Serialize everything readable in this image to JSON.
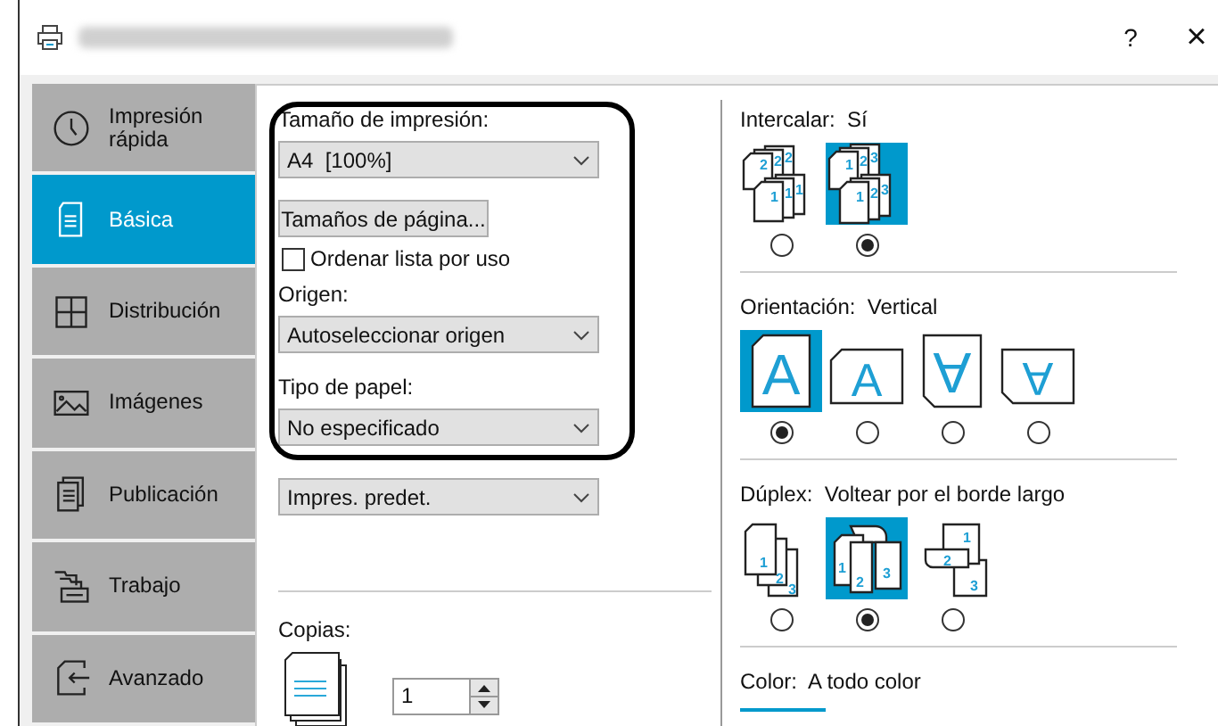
{
  "window": {
    "help": "?",
    "close": "×"
  },
  "sidebar": {
    "items": [
      {
        "label": "Impresión rápida",
        "selected": false
      },
      {
        "label": "Básica",
        "selected": true
      },
      {
        "label": "Distribución",
        "selected": false
      },
      {
        "label": "Imágenes",
        "selected": false
      },
      {
        "label": "Publicación",
        "selected": false
      },
      {
        "label": "Trabajo",
        "selected": false
      },
      {
        "label": "Avanzado",
        "selected": false
      }
    ]
  },
  "print_size": {
    "label": "Tamaño de impresión:",
    "value": "A4  [100%]"
  },
  "page_sizes_button": "Tamaños de página...",
  "sort_by_use": {
    "label": "Ordenar lista por uso",
    "checked": false
  },
  "source": {
    "label": "Origen:",
    "value": "Autoseleccionar origen"
  },
  "paper_type": {
    "label": "Tipo de papel:",
    "value": "No especificado"
  },
  "destination": {
    "value": "Impres. predet."
  },
  "copies": {
    "label": "Copias:",
    "value": "1"
  },
  "collate": {
    "label": "Intercalar:",
    "value": "Sí",
    "options": [
      {
        "kind": "uncollated",
        "marks": [
          "2",
          "2",
          "2",
          "1",
          "1",
          "1"
        ],
        "selected": false
      },
      {
        "kind": "collated",
        "marks": [
          "1",
          "2",
          "3",
          "1",
          "2",
          "3"
        ],
        "selected": true
      }
    ]
  },
  "orientation": {
    "label": "Orientación:",
    "value": "Vertical",
    "options": [
      {
        "kind": "portrait",
        "marks": [
          "A"
        ],
        "selected": true
      },
      {
        "kind": "landscape",
        "marks": [
          "A"
        ],
        "selected": false
      },
      {
        "kind": "portrait-rotated",
        "marks": [
          "A"
        ],
        "selected": false
      },
      {
        "kind": "landscape-rotated",
        "marks": [
          "A"
        ],
        "selected": false
      }
    ]
  },
  "duplex": {
    "label": "Dúplex:",
    "value": "Voltear por el borde largo",
    "options": [
      {
        "kind": "simplex",
        "marks": [
          "1",
          "2",
          "3"
        ],
        "selected": false
      },
      {
        "kind": "long-edge",
        "marks": [
          "1",
          "2",
          "3"
        ],
        "selected": true
      },
      {
        "kind": "short-edge",
        "marks": [
          "1",
          "2",
          "3"
        ],
        "selected": false
      }
    ]
  },
  "color": {
    "label": "Color:",
    "value": "A todo color"
  }
}
